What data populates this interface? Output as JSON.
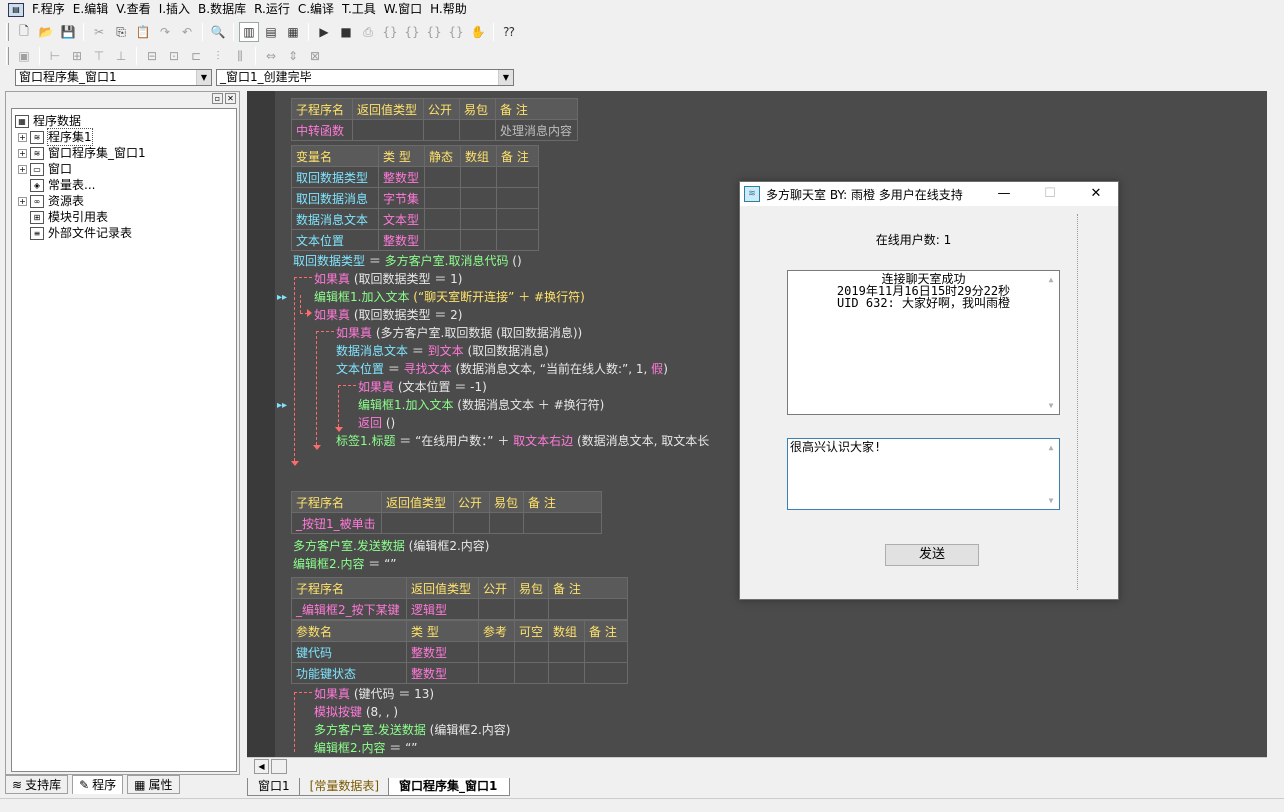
{
  "menu": [
    {
      "label": "F.程序"
    },
    {
      "label": "E.编辑"
    },
    {
      "label": "V.查看"
    },
    {
      "label": "I.插入"
    },
    {
      "label": "B.数据库"
    },
    {
      "label": "R.运行"
    },
    {
      "label": "C.编译"
    },
    {
      "label": "T.工具"
    },
    {
      "label": "W.窗口"
    },
    {
      "label": "H.帮助"
    }
  ],
  "combos": {
    "left": "窗口程序集_窗口1",
    "right": "_窗口1_创建完毕"
  },
  "tree": {
    "root": "程序数据",
    "items": [
      {
        "label": "程序集1",
        "icon": "stack-icon",
        "expandable": true
      },
      {
        "label": "窗口程序集_窗口1",
        "icon": "stack-icon",
        "expandable": true
      },
      {
        "label": "窗口",
        "icon": "window-icon",
        "expandable": true
      },
      {
        "label": "常量表...",
        "icon": "constant-icon",
        "expandable": false
      },
      {
        "label": "资源表",
        "icon": "resource-icon",
        "expandable": true
      },
      {
        "label": "模块引用表",
        "icon": "module-icon",
        "expandable": false
      },
      {
        "label": "外部文件记录表",
        "icon": "file-icon",
        "expandable": false
      }
    ]
  },
  "left_tabs": [
    {
      "label": "支持库"
    },
    {
      "label": "程序"
    },
    {
      "label": "属性"
    }
  ],
  "code": {
    "sub1_headers": [
      "子程序名",
      "返回值类型",
      "公开",
      "易包",
      "备 注"
    ],
    "sub1_row": [
      "中转函数",
      "",
      "",
      "",
      "处理消息内容"
    ],
    "var_headers": [
      "变量名",
      "类 型",
      "静态",
      "数组",
      "备 注"
    ],
    "var_rows": [
      [
        "取回数据类型",
        "整数型"
      ],
      [
        "取回数据消息",
        "字节集"
      ],
      [
        "数据消息文本",
        "文本型"
      ],
      [
        "文本位置",
        "整数型"
      ]
    ],
    "lines": {
      "l1a": "取回数据类型",
      "l1b": " ＝ ",
      "l1c": "多方客户室.取消息代码",
      "l1d": " ()",
      "l2a": "如果真",
      "l2b": " (取回数据类型 ＝ 1)",
      "l3a": "编辑框1.加入文本",
      "l3b": " (“聊天室断开连接” ＋ #换行符)",
      "l4a": "如果真",
      "l4b": " (取回数据类型 ＝ 2)",
      "l5a": "如果真",
      "l5b": " (多方客户室.取回数据 (取回数据消息))",
      "l6a": "数据消息文本",
      "l6b": " ＝ ",
      "l6c": "到文本",
      "l6d": " (取回数据消息)",
      "l7a": "文本位置",
      "l7b": " ＝ ",
      "l7c": "寻找文本",
      "l7d": " (数据消息文本, “当前在线人数:”, 1, ",
      "l7e": "假",
      ")": ")",
      "l8a": "如果真",
      "l8b": " (文本位置 ＝ -1)",
      "l9a": "编辑框1.加入文本",
      "l9b": " (数据消息文本 ＋ #换行符)",
      "l10a": "返回",
      "l10b": " ()",
      "l11a": "标签1.标题",
      "l11b": " ＝ “在线用户数：” ＋ ",
      "l11c": "取文本右边",
      "l11d": " (数据消息文本, 取文本长"
    },
    "sub2_headers": [
      "子程序名",
      "返回值类型",
      "公开",
      "易包",
      "备 注"
    ],
    "sub2_row": [
      "_按钮1_被单击",
      "",
      "",
      "",
      ""
    ],
    "s2l1a": "多方客户室.发送数据",
    "s2l1b": " (编辑框2.内容)",
    "s2l2a": "编辑框2.内容",
    "s2l2b": " ＝ “”",
    "sub3_headers": [
      "子程序名",
      "返回值类型",
      "公开",
      "易包",
      "备 注"
    ],
    "sub3_row": [
      "_编辑框2_按下某键",
      "逻辑型",
      "",
      "",
      ""
    ],
    "param_headers": [
      "参数名",
      "类 型",
      "参考",
      "可空",
      "数组",
      "备 注"
    ],
    "param_rows": [
      [
        "键代码",
        "整数型"
      ],
      [
        "功能键状态",
        "整数型"
      ]
    ],
    "s3l1a": "如果真",
    "s3l1b": " (键代码 ＝ 13)",
    "s3l2a": "模拟按键",
    "s3l2b": " (8, , )",
    "s3l3a": "多方客户室.发送数据",
    "s3l3b": " (编辑框2.内容)",
    "s3l4a": "编辑框2.内容",
    "s3l4b": " ＝ “”"
  },
  "bottom_tabs": [
    {
      "label": "窗口1"
    },
    {
      "label": "[常量数据表]"
    },
    {
      "label": "窗口程序集_窗口1"
    }
  ],
  "chat": {
    "title": "多方聊天室 BY: 雨橙 多用户在线支持",
    "online": "在线用户数: 1",
    "messages": [
      "连接聊天室成功",
      "2019年11月16日15时29分22秒",
      "UID 632: 大家好啊，我叫雨橙"
    ],
    "input": "很高兴认识大家!",
    "send": "发送"
  },
  "colors": {
    "editor_bg": "#4b4b4b",
    "keyword": "#ff7ad9",
    "object": "#8cff8c",
    "var": "#7fe4ff"
  }
}
